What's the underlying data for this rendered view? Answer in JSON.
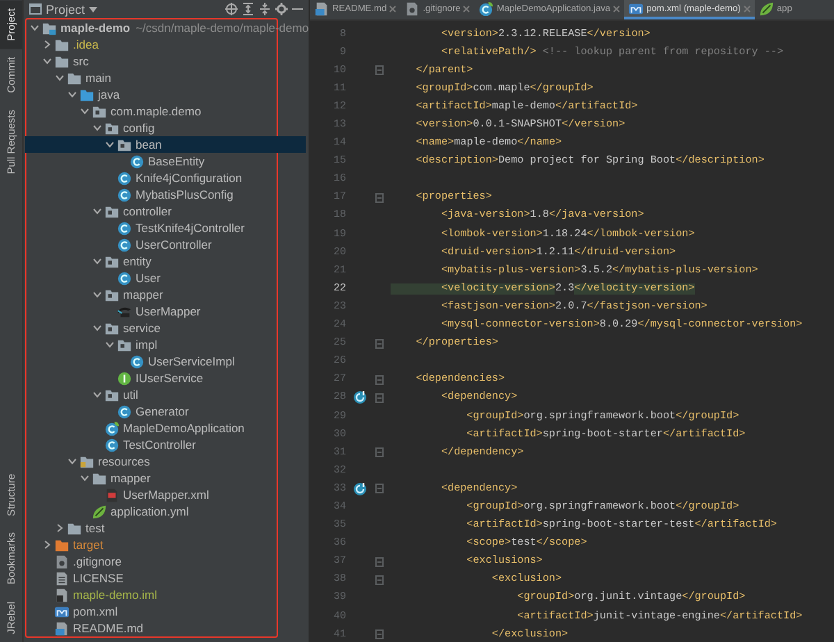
{
  "tool_strip": {
    "top": [
      {
        "label": "Project",
        "selected": true
      },
      {
        "label": "Commit",
        "selected": false
      },
      {
        "label": "Pull Requests",
        "selected": false
      }
    ],
    "bottom": [
      {
        "label": "Structure",
        "selected": false
      },
      {
        "label": "Bookmarks",
        "selected": false
      },
      {
        "label": "JRebel",
        "selected": false
      }
    ]
  },
  "project_panel": {
    "title": "Project",
    "tree": [
      {
        "label": "maple-demo",
        "path": "~/csdn/maple-demo/maple-demo",
        "kind": "module",
        "expanded": true,
        "selected": false,
        "children": [
          {
            "label": ".idea",
            "kind": "folder",
            "expanded": false,
            "selected": false,
            "color": "#c9b84c"
          },
          {
            "label": "src",
            "kind": "folder",
            "expanded": true,
            "selected": false,
            "children": [
              {
                "label": "main",
                "kind": "folder",
                "expanded": true,
                "selected": false,
                "children": [
                  {
                    "label": "java",
                    "kind": "source",
                    "expanded": true,
                    "selected": false,
                    "children": [
                      {
                        "label": "com.maple.demo",
                        "kind": "package",
                        "expanded": true,
                        "selected": false,
                        "children": [
                          {
                            "label": "config",
                            "kind": "package",
                            "expanded": true,
                            "selected": false,
                            "children": [
                              {
                                "label": "bean",
                                "kind": "package",
                                "expanded": true,
                                "selected": true,
                                "children": [
                                  {
                                    "label": "BaseEntity",
                                    "kind": "class",
                                    "selected": false
                                  }
                                ]
                              },
                              {
                                "label": "Knife4jConfiguration",
                                "kind": "class",
                                "selected": false
                              },
                              {
                                "label": "MybatisPlusConfig",
                                "kind": "class",
                                "selected": false
                              }
                            ]
                          },
                          {
                            "label": "controller",
                            "kind": "package",
                            "expanded": true,
                            "selected": false,
                            "children": [
                              {
                                "label": "TestKnife4jController",
                                "kind": "class",
                                "selected": false
                              },
                              {
                                "label": "UserController",
                                "kind": "class",
                                "selected": false
                              }
                            ]
                          },
                          {
                            "label": "entity",
                            "kind": "package",
                            "expanded": true,
                            "selected": false,
                            "children": [
                              {
                                "label": "User",
                                "kind": "class",
                                "selected": false
                              }
                            ]
                          },
                          {
                            "label": "mapper",
                            "kind": "package",
                            "expanded": true,
                            "selected": false,
                            "children": [
                              {
                                "label": "UserMapper",
                                "kind": "mybatis",
                                "selected": false
                              }
                            ]
                          },
                          {
                            "label": "service",
                            "kind": "package",
                            "expanded": true,
                            "selected": false,
                            "children": [
                              {
                                "label": "impl",
                                "kind": "package",
                                "expanded": true,
                                "selected": false,
                                "children": [
                                  {
                                    "label": "UserServiceImpl",
                                    "kind": "class",
                                    "selected": false
                                  }
                                ]
                              },
                              {
                                "label": "IUserService",
                                "kind": "interface",
                                "selected": false
                              }
                            ]
                          },
                          {
                            "label": "util",
                            "kind": "package",
                            "expanded": true,
                            "selected": false,
                            "children": [
                              {
                                "label": "Generator",
                                "kind": "class",
                                "selected": false
                              }
                            ]
                          },
                          {
                            "label": "MapleDemoApplication",
                            "kind": "spring-class",
                            "selected": false
                          },
                          {
                            "label": "TestController",
                            "kind": "class",
                            "selected": false
                          }
                        ]
                      }
                    ]
                  },
                  {
                    "label": "resources",
                    "kind": "resources",
                    "expanded": true,
                    "selected": false,
                    "children": [
                      {
                        "label": "mapper",
                        "kind": "folder",
                        "expanded": true,
                        "selected": false,
                        "children": [
                          {
                            "label": "UserMapper.xml",
                            "kind": "mybatis-xml",
                            "selected": false
                          }
                        ]
                      },
                      {
                        "label": "application.yml",
                        "kind": "yml",
                        "selected": false
                      }
                    ]
                  }
                ]
              },
              {
                "label": "test",
                "kind": "folder",
                "expanded": false,
                "selected": false
              }
            ]
          },
          {
            "label": "target",
            "kind": "excluded",
            "expanded": false,
            "selected": false,
            "color": "#d6893a"
          },
          {
            "label": ".gitignore",
            "kind": "gitignore",
            "selected": false
          },
          {
            "label": "LICENSE",
            "kind": "text",
            "selected": false
          },
          {
            "label": "maple-demo.iml",
            "kind": "iml",
            "selected": false,
            "color": "#a6b64a"
          },
          {
            "label": "pom.xml",
            "kind": "maven",
            "selected": false
          },
          {
            "label": "README.md",
            "kind": "markdown",
            "selected": false
          }
        ]
      }
    ]
  },
  "editor": {
    "tabs": [
      {
        "label": "README.md",
        "kind": "markdown",
        "selected": false,
        "closable": true
      },
      {
        "label": ".gitignore",
        "kind": "gitignore",
        "selected": false,
        "closable": true
      },
      {
        "label": "MapleDemoApplication.java",
        "kind": "spring-class",
        "selected": false,
        "closable": true
      },
      {
        "label": "pom.xml (maple-demo)",
        "kind": "maven",
        "selected": true,
        "closable": true
      },
      {
        "label": "app",
        "kind": "yml",
        "selected": false,
        "closable": false
      }
    ],
    "lines": [
      {
        "number": "8",
        "current": false,
        "fold": false,
        "gutter_icon": false,
        "segments": [
          {
            "kind": "tag",
            "text": "        <version>"
          },
          {
            "kind": "text",
            "text": "2.3.12.RELEASE"
          },
          {
            "kind": "tag",
            "text": "</version>"
          }
        ]
      },
      {
        "number": "9",
        "current": false,
        "fold": false,
        "gutter_icon": false,
        "segments": [
          {
            "kind": "tag",
            "text": "        <relativePath/>"
          },
          {
            "kind": "comment",
            "text": " <!-- lookup parent from repository -->"
          }
        ]
      },
      {
        "number": "10",
        "current": false,
        "fold": true,
        "gutter_icon": false,
        "segments": [
          {
            "kind": "tag",
            "text": "    </parent>"
          }
        ]
      },
      {
        "number": "11",
        "current": false,
        "fold": false,
        "gutter_icon": false,
        "segments": [
          {
            "kind": "tag",
            "text": "    <groupId>"
          },
          {
            "kind": "text",
            "text": "com.maple"
          },
          {
            "kind": "tag",
            "text": "</groupId>"
          }
        ]
      },
      {
        "number": "12",
        "current": false,
        "fold": false,
        "gutter_icon": false,
        "segments": [
          {
            "kind": "tag",
            "text": "    <artifactId>"
          },
          {
            "kind": "text",
            "text": "maple-demo"
          },
          {
            "kind": "tag",
            "text": "</artifactId>"
          }
        ]
      },
      {
        "number": "13",
        "current": false,
        "fold": false,
        "gutter_icon": false,
        "segments": [
          {
            "kind": "tag",
            "text": "    <version>"
          },
          {
            "kind": "text",
            "text": "0.0.1-SNAPSHOT"
          },
          {
            "kind": "tag",
            "text": "</version>"
          }
        ]
      },
      {
        "number": "14",
        "current": false,
        "fold": false,
        "gutter_icon": false,
        "segments": [
          {
            "kind": "tag",
            "text": "    <name>"
          },
          {
            "kind": "text",
            "text": "maple-demo"
          },
          {
            "kind": "tag",
            "text": "</name>"
          }
        ]
      },
      {
        "number": "15",
        "current": false,
        "fold": false,
        "gutter_icon": false,
        "segments": [
          {
            "kind": "tag",
            "text": "    <description>"
          },
          {
            "kind": "text",
            "text": "Demo project for Spring Boot"
          },
          {
            "kind": "tag",
            "text": "</description>"
          }
        ]
      },
      {
        "number": "16",
        "current": false,
        "fold": false,
        "gutter_icon": false
      },
      {
        "number": "17",
        "current": false,
        "fold": true,
        "gutter_icon": false,
        "segments": [
          {
            "kind": "tag",
            "text": "    <properties>"
          }
        ]
      },
      {
        "number": "18",
        "current": false,
        "fold": false,
        "gutter_icon": false,
        "segments": [
          {
            "kind": "tag",
            "text": "        <java-version>"
          },
          {
            "kind": "text",
            "text": "1.8"
          },
          {
            "kind": "tag",
            "text": "</java-version>"
          }
        ]
      },
      {
        "number": "19",
        "current": false,
        "fold": false,
        "gutter_icon": false,
        "segments": [
          {
            "kind": "tag",
            "text": "        <lombok-version>"
          },
          {
            "kind": "text",
            "text": "1.18.24"
          },
          {
            "kind": "tag",
            "text": "</lombok-version>"
          }
        ]
      },
      {
        "number": "20",
        "current": false,
        "fold": false,
        "gutter_icon": false,
        "segments": [
          {
            "kind": "tag",
            "text": "        <druid-version>"
          },
          {
            "kind": "text",
            "text": "1.2.11"
          },
          {
            "kind": "tag",
            "text": "</druid-version>"
          }
        ]
      },
      {
        "number": "21",
        "current": false,
        "fold": false,
        "gutter_icon": false,
        "segments": [
          {
            "kind": "tag",
            "text": "        <mybatis-plus-version>"
          },
          {
            "kind": "text",
            "text": "3.5.2"
          },
          {
            "kind": "tag",
            "text": "</mybatis-plus-version>"
          }
        ]
      },
      {
        "number": "22",
        "current": true,
        "fold": false,
        "gutter_icon": false,
        "segments": [
          {
            "kind": "tag",
            "text": "        <velocity-version>"
          },
          {
            "kind": "text",
            "text": "2.3"
          },
          {
            "kind": "tag",
            "text": "</velocity-version>"
          }
        ]
      },
      {
        "number": "23",
        "current": false,
        "fold": false,
        "gutter_icon": false,
        "segments": [
          {
            "kind": "tag",
            "text": "        <fastjson-version>"
          },
          {
            "kind": "text",
            "text": "2.0.7"
          },
          {
            "kind": "tag",
            "text": "</fastjson-version>"
          }
        ]
      },
      {
        "number": "24",
        "current": false,
        "fold": false,
        "gutter_icon": false,
        "segments": [
          {
            "kind": "tag",
            "text": "        <mysql-connector-version>"
          },
          {
            "kind": "text",
            "text": "8.0.29"
          },
          {
            "kind": "tag",
            "text": "</mysql-connector-version>"
          }
        ]
      },
      {
        "number": "25",
        "current": false,
        "fold": true,
        "gutter_icon": false,
        "segments": [
          {
            "kind": "tag",
            "text": "    </properties>"
          }
        ]
      },
      {
        "number": "26",
        "current": false,
        "fold": false,
        "gutter_icon": false
      },
      {
        "number": "27",
        "current": false,
        "fold": true,
        "gutter_icon": false,
        "segments": [
          {
            "kind": "tag",
            "text": "    <dependencies>"
          }
        ]
      },
      {
        "number": "28",
        "current": false,
        "fold": true,
        "gutter_icon": true,
        "segments": [
          {
            "kind": "tag",
            "text": "        <dependency>"
          }
        ]
      },
      {
        "number": "29",
        "current": false,
        "fold": false,
        "gutter_icon": false,
        "segments": [
          {
            "kind": "tag",
            "text": "            <groupId>"
          },
          {
            "kind": "text",
            "text": "org.springframework.boot"
          },
          {
            "kind": "tag",
            "text": "</groupId>"
          }
        ]
      },
      {
        "number": "30",
        "current": false,
        "fold": false,
        "gutter_icon": false,
        "segments": [
          {
            "kind": "tag",
            "text": "            <artifactId>"
          },
          {
            "kind": "text",
            "text": "spring-boot-starter"
          },
          {
            "kind": "tag",
            "text": "</artifactId>"
          }
        ]
      },
      {
        "number": "31",
        "current": false,
        "fold": true,
        "gutter_icon": false,
        "segments": [
          {
            "kind": "tag",
            "text": "        </dependency>"
          }
        ]
      },
      {
        "number": "32",
        "current": false,
        "fold": false,
        "gutter_icon": false
      },
      {
        "number": "33",
        "current": false,
        "fold": true,
        "gutter_icon": true,
        "segments": [
          {
            "kind": "tag",
            "text": "        <dependency>"
          }
        ]
      },
      {
        "number": "34",
        "current": false,
        "fold": false,
        "gutter_icon": false,
        "segments": [
          {
            "kind": "tag",
            "text": "            <groupId>"
          },
          {
            "kind": "text",
            "text": "org.springframework.boot"
          },
          {
            "kind": "tag",
            "text": "</groupId>"
          }
        ]
      },
      {
        "number": "35",
        "current": false,
        "fold": false,
        "gutter_icon": false,
        "segments": [
          {
            "kind": "tag",
            "text": "            <artifactId>"
          },
          {
            "kind": "text",
            "text": "spring-boot-starter-test"
          },
          {
            "kind": "tag",
            "text": "</artifactId>"
          }
        ]
      },
      {
        "number": "36",
        "current": false,
        "fold": false,
        "gutter_icon": false,
        "segments": [
          {
            "kind": "tag",
            "text": "            <scope>"
          },
          {
            "kind": "text",
            "text": "test"
          },
          {
            "kind": "tag",
            "text": "</scope>"
          }
        ]
      },
      {
        "number": "37",
        "current": false,
        "fold": true,
        "gutter_icon": false,
        "segments": [
          {
            "kind": "tag",
            "text": "            <exclusions>"
          }
        ]
      },
      {
        "number": "38",
        "current": false,
        "fold": true,
        "gutter_icon": false,
        "segments": [
          {
            "kind": "tag",
            "text": "                <exclusion>"
          }
        ]
      },
      {
        "number": "39",
        "current": false,
        "fold": false,
        "gutter_icon": false,
        "segments": [
          {
            "kind": "tag",
            "text": "                    <groupId>"
          },
          {
            "kind": "text",
            "text": "org.junit.vintage"
          },
          {
            "kind": "tag",
            "text": "</groupId>"
          }
        ]
      },
      {
        "number": "40",
        "current": false,
        "fold": false,
        "gutter_icon": false,
        "segments": [
          {
            "kind": "tag",
            "text": "                    <artifactId>"
          },
          {
            "kind": "text",
            "text": "junit-vintage-engine"
          },
          {
            "kind": "tag",
            "text": "</artifactId>"
          }
        ]
      },
      {
        "number": "41",
        "current": false,
        "fold": true,
        "gutter_icon": false,
        "segments": [
          {
            "kind": "tag",
            "text": "                </exclusion>"
          }
        ]
      }
    ]
  }
}
